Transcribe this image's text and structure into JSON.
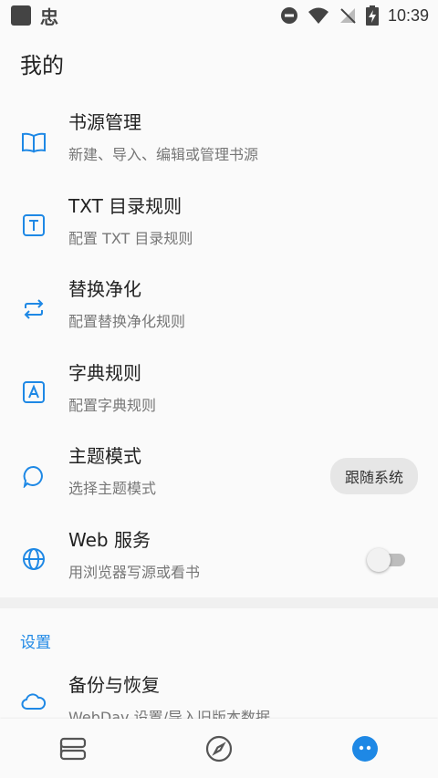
{
  "status_bar": {
    "time": "10:39",
    "app_glyph": "忠"
  },
  "page_title": "我的",
  "items": [
    {
      "title": "书源管理",
      "subtitle": "新建、导入、编辑或管理书源",
      "icon": "book-open-icon"
    },
    {
      "title": "TXT 目录规则",
      "subtitle": "配置 TXT 目录规则",
      "icon": "text-t-icon"
    },
    {
      "title": "替换净化",
      "subtitle": "配置替换净化规则",
      "icon": "swap-icon"
    },
    {
      "title": "字典规则",
      "subtitle": "配置字典规则",
      "icon": "letter-a-icon"
    },
    {
      "title": "主题模式",
      "subtitle": "选择主题模式",
      "icon": "chat-bubble-icon",
      "value": "跟随系统"
    },
    {
      "title": "Web 服务",
      "subtitle": "用浏览器写源或看书",
      "icon": "globe-icon",
      "toggle": false
    }
  ],
  "section": {
    "label": "设置"
  },
  "backup": {
    "title": "备份与恢复",
    "subtitle": "WebDav 设置/导入旧版本数据",
    "icon": "cloud-icon"
  },
  "colors": {
    "accent": "#1e88e5",
    "background": "#fafafa"
  },
  "bottom_nav": [
    {
      "icon": "bookshelf-icon"
    },
    {
      "icon": "compass-icon"
    },
    {
      "icon": "profile-face-icon",
      "active": true
    }
  ]
}
